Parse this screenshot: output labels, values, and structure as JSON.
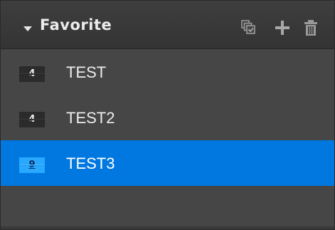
{
  "panel": {
    "title": "Favorite",
    "collapse_icon": "caret-down-icon",
    "actions": [
      {
        "name": "copy-check-icon"
      },
      {
        "name": "add-icon"
      },
      {
        "name": "trash-icon"
      }
    ]
  },
  "favorites": [
    {
      "badge": "4",
      "label": "TEST",
      "selected": false
    },
    {
      "badge": "4",
      "label": "TEST2",
      "selected": false
    },
    {
      "badge": "9",
      "label": "TEST3",
      "selected": true
    }
  ],
  "colors": {
    "panel_bg": "#464646",
    "header_bg": "#3a3a3a",
    "selection": "#0078e0",
    "badge_bg": "#2b2b2b",
    "badge_selected_bg": "#29a8ff",
    "text": "#ededed"
  }
}
